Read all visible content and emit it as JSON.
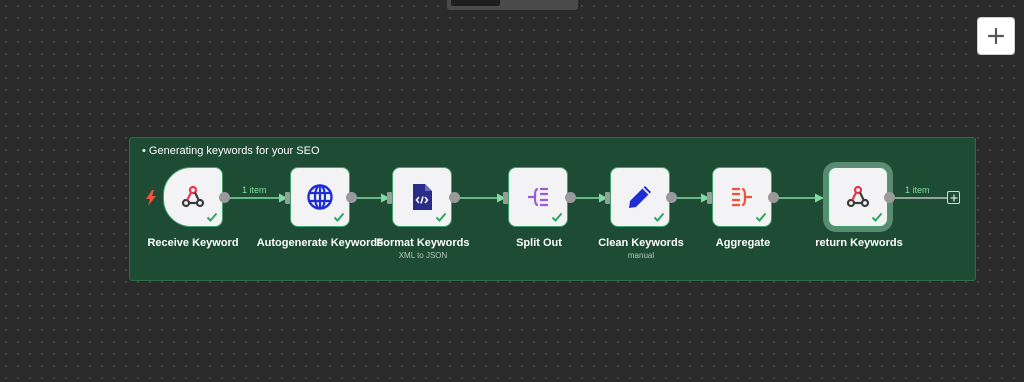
{
  "zoom": {
    "icon": "plus-icon"
  },
  "group": {
    "title": "Generating keywords for your SEO"
  },
  "colors": {
    "canvas": "#2a2a2a",
    "group_fill": "#1e4b34",
    "node_border": "#3ea46a",
    "connection": "#7fdca0",
    "webhook_red": "#e9344a",
    "globe_blue": "#1e2ed6",
    "xml_navy": "#2b2b88",
    "split_purple": "#9b5bd6",
    "aggregate_red": "#f0523a"
  },
  "nodes": [
    {
      "label": "Receive Keyword",
      "sub": "",
      "icon": "webhook-icon"
    },
    {
      "label": "Autogenerate Keywords",
      "sub": "",
      "icon": "globe-icon"
    },
    {
      "label": "Format Keywords",
      "sub": "XML to JSON",
      "icon": "file-code-icon"
    },
    {
      "label": "Split Out",
      "sub": "",
      "icon": "split-out-icon"
    },
    {
      "label": "Clean Keywords",
      "sub": "manual",
      "icon": "pencil-icon"
    },
    {
      "label": "Aggregate",
      "sub": "",
      "icon": "aggregate-icon"
    },
    {
      "label": "return Keywords",
      "sub": "",
      "icon": "webhook-icon"
    }
  ],
  "connections": {
    "first_count": "1 item",
    "last_count": "1 item"
  }
}
